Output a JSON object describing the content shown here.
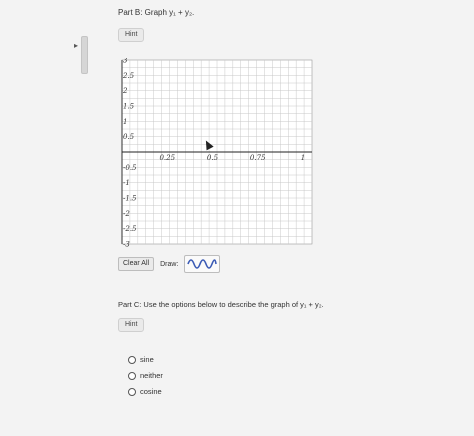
{
  "part_b": {
    "title": "Part B: Graph y₁ + y₂.",
    "hint_label": "Hint"
  },
  "graph": {
    "x_ticks": [
      "0.25",
      "0.5",
      "0.75",
      "1"
    ],
    "y_ticks": [
      "3",
      "2.5",
      "2",
      "1.5",
      "1",
      "0.5",
      "-0.5",
      "-1",
      "-1.5",
      "-2",
      "-2.5",
      "-3"
    ],
    "x_range": [
      0,
      1.05
    ],
    "y_range": [
      -3,
      3
    ]
  },
  "toolbar": {
    "clear_label": "Clear All",
    "draw_label": "Draw:",
    "draw_tool_icon": "sine-wave-icon",
    "draw_tool_color": "#3b5bb5"
  },
  "part_c": {
    "title": "Part C: Use the options below to describe the graph of y₁ + y₂.",
    "hint_label": "Hint",
    "options": [
      "sine",
      "neither",
      "cosine"
    ]
  }
}
